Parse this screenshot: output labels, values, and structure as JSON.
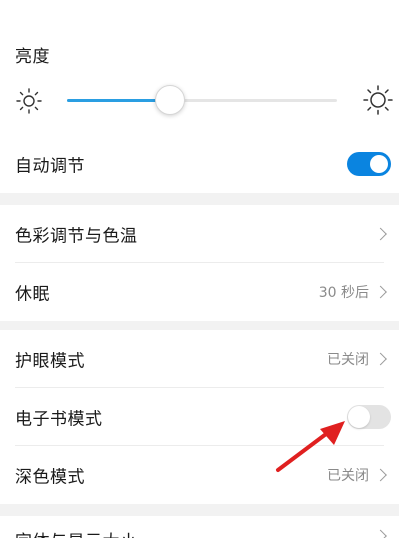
{
  "brightness": {
    "title": "亮度",
    "level": 0.38
  },
  "settings": {
    "auto_adjust": {
      "label": "自动调节",
      "enabled": true
    },
    "color_temp": {
      "label": "色彩调节与色温"
    },
    "sleep": {
      "label": "休眠",
      "value": "30 秒后"
    },
    "eye_comfort": {
      "label": "护眼模式",
      "value": "已关闭"
    },
    "ebook_mode": {
      "label": "电子书模式",
      "enabled": false
    },
    "dark_mode": {
      "label": "深色模式",
      "value": "已关闭"
    },
    "next_item": {
      "label": "字体与显示大小"
    }
  },
  "colors": {
    "accent": "#0a84e0",
    "slider_fill": "#2a9ee2",
    "annotation_arrow": "#e02020"
  },
  "icons": {
    "brightness_low": "sun-small-icon",
    "brightness_high": "sun-large-icon",
    "chevron": "chevron-right-icon",
    "annotation": "red-arrow-icon"
  }
}
